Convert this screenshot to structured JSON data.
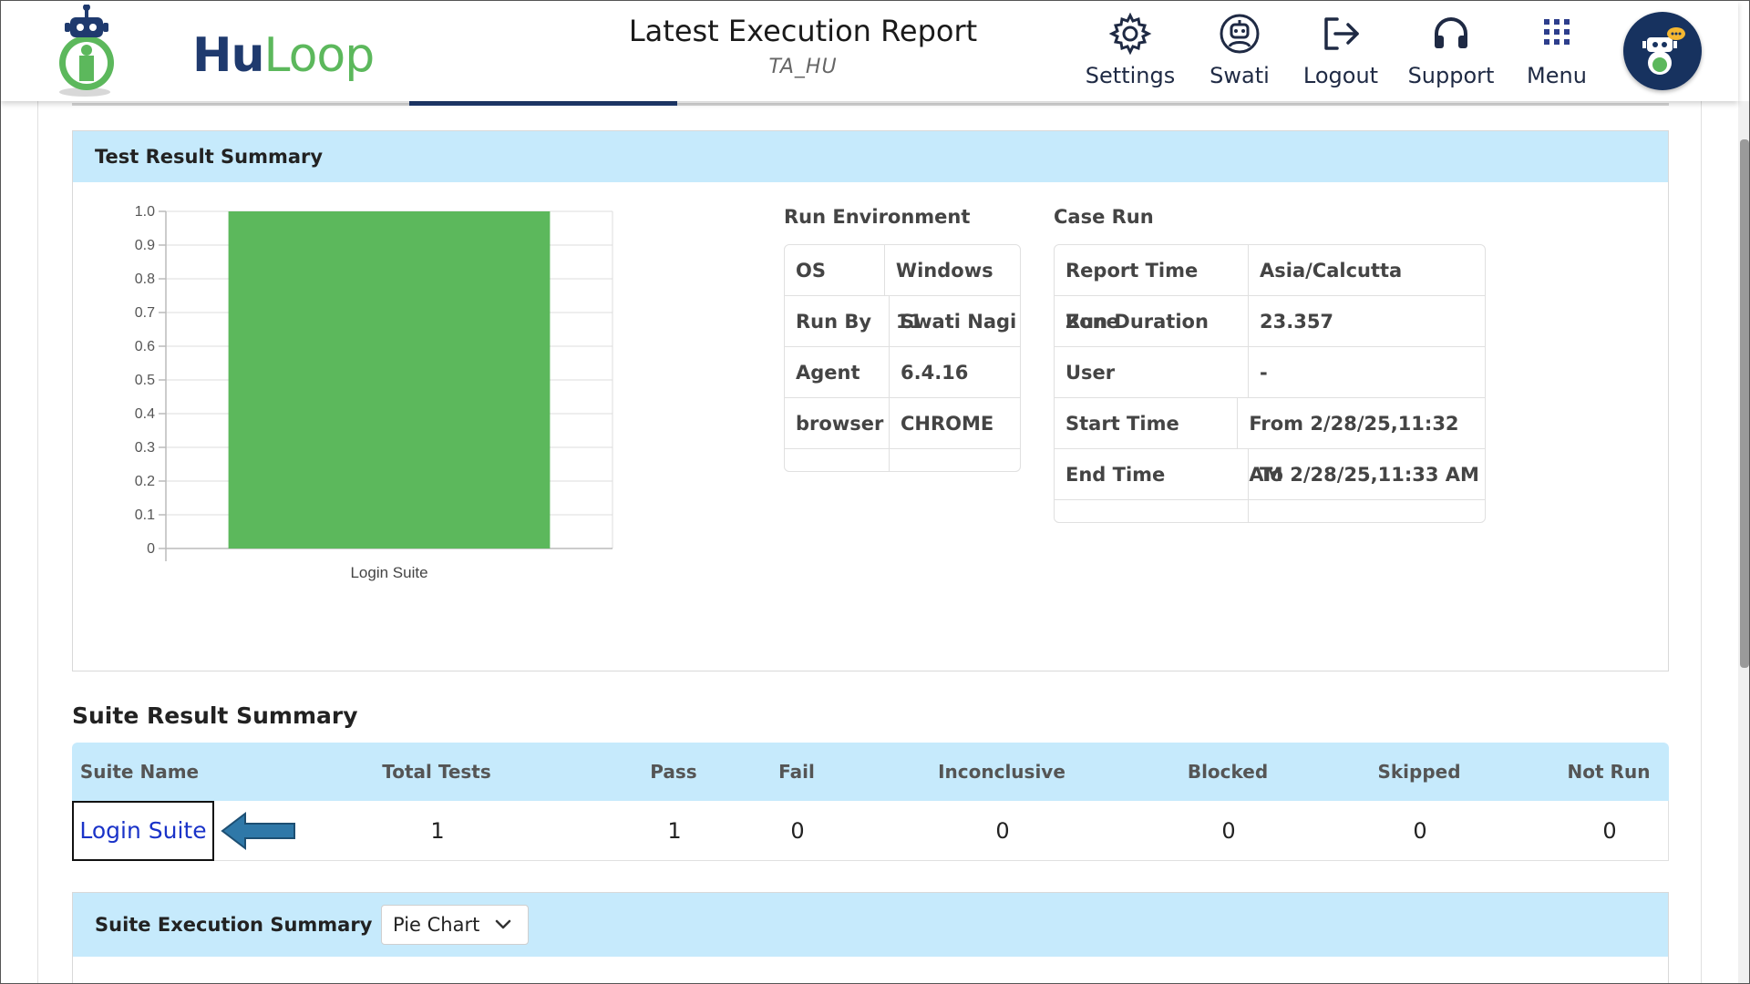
{
  "header": {
    "logo": {
      "hu": "Hu",
      "loop": "Loop"
    },
    "title": "Latest Execution Report",
    "subtitle": "TA_HU",
    "nav": [
      {
        "label": "Settings",
        "icon": "gear-icon"
      },
      {
        "label": "Swati",
        "icon": "user-robot-icon"
      },
      {
        "label": "Logout",
        "icon": "logout-icon"
      },
      {
        "label": "Support",
        "icon": "headset-icon"
      },
      {
        "label": "Menu",
        "icon": "grid-icon"
      }
    ],
    "avatar_icon": "bot-chat-icon"
  },
  "test_result_summary": {
    "title": "Test Result Summary",
    "run_environment": {
      "label": "Run Environment",
      "rows": [
        {
          "k": "OS",
          "v": "Windows 11"
        },
        {
          "k": "Run By",
          "v": "Swati Nagi"
        },
        {
          "k": "Agent",
          "v": "6.4.16"
        },
        {
          "k": "browser",
          "v": "CHROME"
        }
      ]
    },
    "case_run": {
      "label": "Case Run",
      "rows": [
        {
          "k": "Report Time Zone",
          "v": "Asia/Calcutta"
        },
        {
          "k": "Run Duration",
          "v": "23.357"
        },
        {
          "k": "User",
          "v": "-"
        },
        {
          "k": "Start Time",
          "v": "From 2/28/25,11:32 AM"
        },
        {
          "k": "End Time",
          "v": "To 2/28/25,11:33 AM"
        }
      ]
    }
  },
  "chart_data": {
    "type": "bar",
    "categories": [
      "Login Suite"
    ],
    "values": [
      1.0
    ],
    "ylim": [
      0,
      1.0
    ],
    "yticks": [
      "0",
      "0.1",
      "0.2",
      "0.3",
      "0.4",
      "0.5",
      "0.6",
      "0.7",
      "0.8",
      "0.9",
      "1.0"
    ],
    "color": "#5cb85c",
    "grid": true
  },
  "suite_result_summary": {
    "title": "Suite Result Summary",
    "columns": [
      "Suite Name",
      "Total Tests",
      "Pass",
      "Fail",
      "Inconclusive",
      "Blocked",
      "Skipped",
      "Not Run"
    ],
    "rows": [
      {
        "suite": "Login Suite",
        "total": "1",
        "pass": "1",
        "fail": "0",
        "inconclusive": "0",
        "blocked": "0",
        "skipped": "0",
        "not_run": "0"
      }
    ]
  },
  "suite_execution_summary": {
    "title": "Suite Execution Summary",
    "chart_type_selected": "Pie Chart"
  },
  "colors": {
    "accent_blue": "#1f3a6e",
    "header_bg": "#c6eafc",
    "bar_green": "#5cb85c",
    "link": "#1a33c8"
  }
}
